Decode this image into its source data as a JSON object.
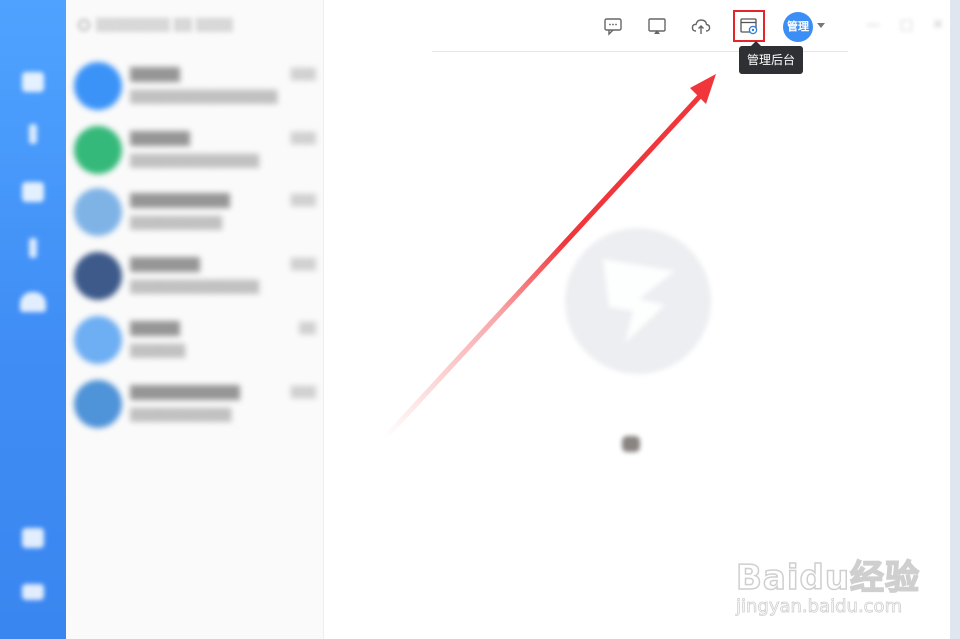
{
  "toolbar": {
    "icons": [
      "chat-icon",
      "screen-share-icon",
      "cloud-upload-icon",
      "admin-console-icon"
    ],
    "user_avatar_label": "管理"
  },
  "tooltip": {
    "text": "管理后台"
  },
  "colors": {
    "rail": "#3f8df5",
    "accent": "#3a8ef5",
    "highlight_box": "#e8242b",
    "arrow": "#f0363b",
    "tooltip_bg": "#2f3033"
  },
  "watermark": {
    "brand": "Baidu经验",
    "sub": "jingyan.baidu.com"
  }
}
